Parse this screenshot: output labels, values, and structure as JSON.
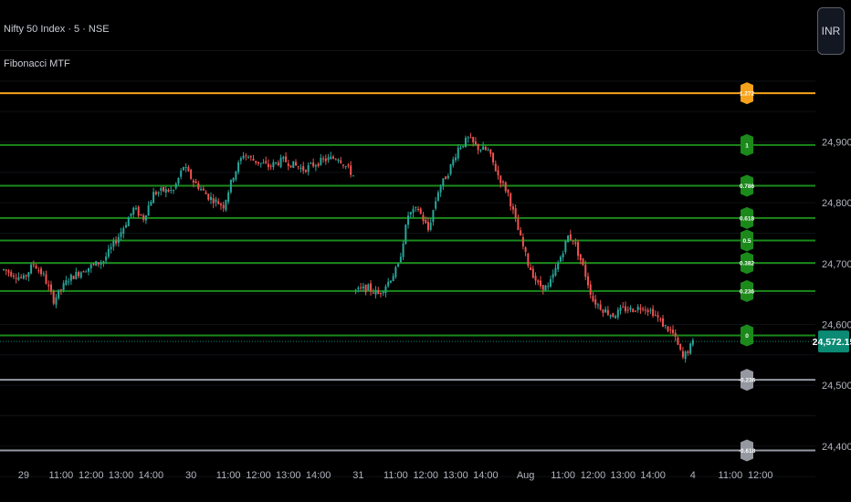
{
  "header": {
    "symbol_line": "Nifty 50 Index · 5 · NSE",
    "indicator_name": "Fibonacci MTF",
    "currency_label": "INR"
  },
  "colors": {
    "background": "#000000",
    "candle_up": "#26a69a",
    "candle_down": "#ef5350",
    "fib_green": "#1b8a1b",
    "fib_orange": "#f7a21b",
    "fib_gray": "#9598a1",
    "last_price_bg": "#0b8a74"
  },
  "fib_levels": [
    {
      "label": "1.272",
      "price": 24980,
      "color": "#f7a21b"
    },
    {
      "label": "1",
      "price": 24895,
      "color": "#1b8a1b"
    },
    {
      "label": "0.786",
      "price": 24828,
      "color": "#1b8a1b"
    },
    {
      "label": "0.618",
      "price": 24775,
      "color": "#1b8a1b"
    },
    {
      "label": "0.5",
      "price": 24738,
      "color": "#1b8a1b"
    },
    {
      "label": "0.382",
      "price": 24701,
      "color": "#1b8a1b"
    },
    {
      "label": "0.236",
      "price": 24655,
      "color": "#1b8a1b"
    },
    {
      "label": "0",
      "price": 24582,
      "color": "#1b8a1b"
    },
    {
      "label": "-0.236",
      "price": 24509,
      "color": "#9598a1"
    },
    {
      "label": "-0.618",
      "price": 24393,
      "color": "#9598a1"
    }
  ],
  "last_price": {
    "label": "24,572.15",
    "price": 24572.15
  },
  "chart_data": {
    "type": "candlestick",
    "symbol": "Nifty 50 Index",
    "timeframe": "5",
    "exchange": "NSE",
    "y_axis": {
      "ticks": [
        {
          "value": 24900,
          "label": "24,900.00"
        },
        {
          "value": 24800,
          "label": "24,800.00"
        },
        {
          "value": 24700,
          "label": "24,700.00"
        },
        {
          "value": 24600,
          "label": "24,600.00"
        },
        {
          "value": 24500,
          "label": "24,500.00"
        },
        {
          "value": 24400,
          "label": "24,400.00"
        }
      ],
      "range": [
        24350,
        25050
      ]
    },
    "x_axis": {
      "ticks": [
        {
          "label": "29",
          "bar": 8
        },
        {
          "label": "11:00",
          "bar": 23
        },
        {
          "label": "12:00",
          "bar": 35
        },
        {
          "label": "13:00",
          "bar": 47
        },
        {
          "label": "14:00",
          "bar": 59
        },
        {
          "label": "30",
          "bar": 75
        },
        {
          "label": "11:00",
          "bar": 90
        },
        {
          "label": "12:00",
          "bar": 102
        },
        {
          "label": "13:00",
          "bar": 114
        },
        {
          "label": "14:00",
          "bar": 126
        },
        {
          "label": "31",
          "bar": 142
        },
        {
          "label": "11:00",
          "bar": 157
        },
        {
          "label": "12:00",
          "bar": 169
        },
        {
          "label": "13:00",
          "bar": 181
        },
        {
          "label": "14:00",
          "bar": 193
        },
        {
          "label": "Aug",
          "bar": 209
        },
        {
          "label": "11:00",
          "bar": 224
        },
        {
          "label": "12:00",
          "bar": 236
        },
        {
          "label": "13:00",
          "bar": 248
        },
        {
          "label": "14:00",
          "bar": 260
        },
        {
          "label": "4",
          "bar": 276
        },
        {
          "label": "11:00",
          "bar": 291
        },
        {
          "label": "12:00",
          "bar": 303
        }
      ]
    },
    "anchors": [
      [
        0,
        24690
      ],
      [
        8,
        24675
      ],
      [
        12,
        24700
      ],
      [
        16,
        24680
      ],
      [
        20,
        24640
      ],
      [
        26,
        24675
      ],
      [
        32,
        24690
      ],
      [
        40,
        24705
      ],
      [
        46,
        24745
      ],
      [
        52,
        24790
      ],
      [
        56,
        24775
      ],
      [
        60,
        24815
      ],
      [
        64,
        24820
      ],
      [
        68,
        24820
      ],
      [
        72,
        24860
      ],
      [
        76,
        24835
      ],
      [
        82,
        24810
      ],
      [
        88,
        24795
      ],
      [
        92,
        24845
      ],
      [
        96,
        24880
      ],
      [
        100,
        24870
      ],
      [
        106,
        24860
      ],
      [
        112,
        24870
      ],
      [
        120,
        24855
      ],
      [
        128,
        24870
      ],
      [
        134,
        24875
      ],
      [
        140,
        24845
      ],
      [
        141,
        24655
      ],
      [
        146,
        24660
      ],
      [
        150,
        24650
      ],
      [
        154,
        24670
      ],
      [
        158,
        24695
      ],
      [
        162,
        24780
      ],
      [
        166,
        24790
      ],
      [
        170,
        24755
      ],
      [
        174,
        24820
      ],
      [
        178,
        24850
      ],
      [
        182,
        24890
      ],
      [
        186,
        24905
      ],
      [
        190,
        24890
      ],
      [
        194,
        24885
      ],
      [
        198,
        24845
      ],
      [
        202,
        24815
      ],
      [
        206,
        24755
      ],
      [
        210,
        24700
      ],
      [
        214,
        24665
      ],
      [
        218,
        24660
      ],
      [
        222,
        24700
      ],
      [
        226,
        24745
      ],
      [
        228,
        24740
      ],
      [
        232,
        24695
      ],
      [
        236,
        24640
      ],
      [
        240,
        24625
      ],
      [
        244,
        24615
      ],
      [
        248,
        24625
      ],
      [
        252,
        24625
      ],
      [
        256,
        24630
      ],
      [
        260,
        24620
      ],
      [
        264,
        24600
      ],
      [
        268,
        24585
      ],
      [
        272,
        24545
      ],
      [
        276,
        24570
      ]
    ]
  }
}
